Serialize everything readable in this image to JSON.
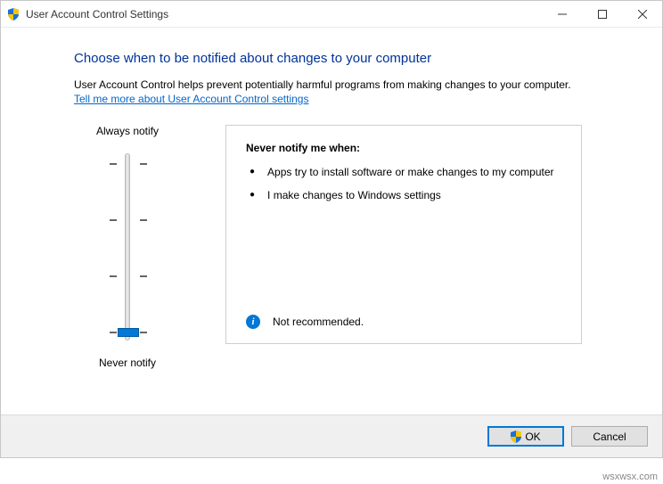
{
  "window": {
    "title": "User Account Control Settings"
  },
  "heading": "Choose when to be notified about changes to your computer",
  "subtext": "User Account Control helps prevent potentially harmful programs from making changes to your computer.",
  "help_link": "Tell me more about User Account Control settings",
  "slider": {
    "top_label": "Always notify",
    "bottom_label": "Never notify",
    "levels": 4,
    "selected_index": 3
  },
  "info_panel": {
    "title": "Never notify me when:",
    "items": [
      "Apps try to install software or make changes to my computer",
      "I make changes to Windows settings"
    ],
    "status_text": "Not recommended."
  },
  "buttons": {
    "ok": "OK",
    "cancel": "Cancel"
  },
  "watermark": "wsxwsx.com"
}
